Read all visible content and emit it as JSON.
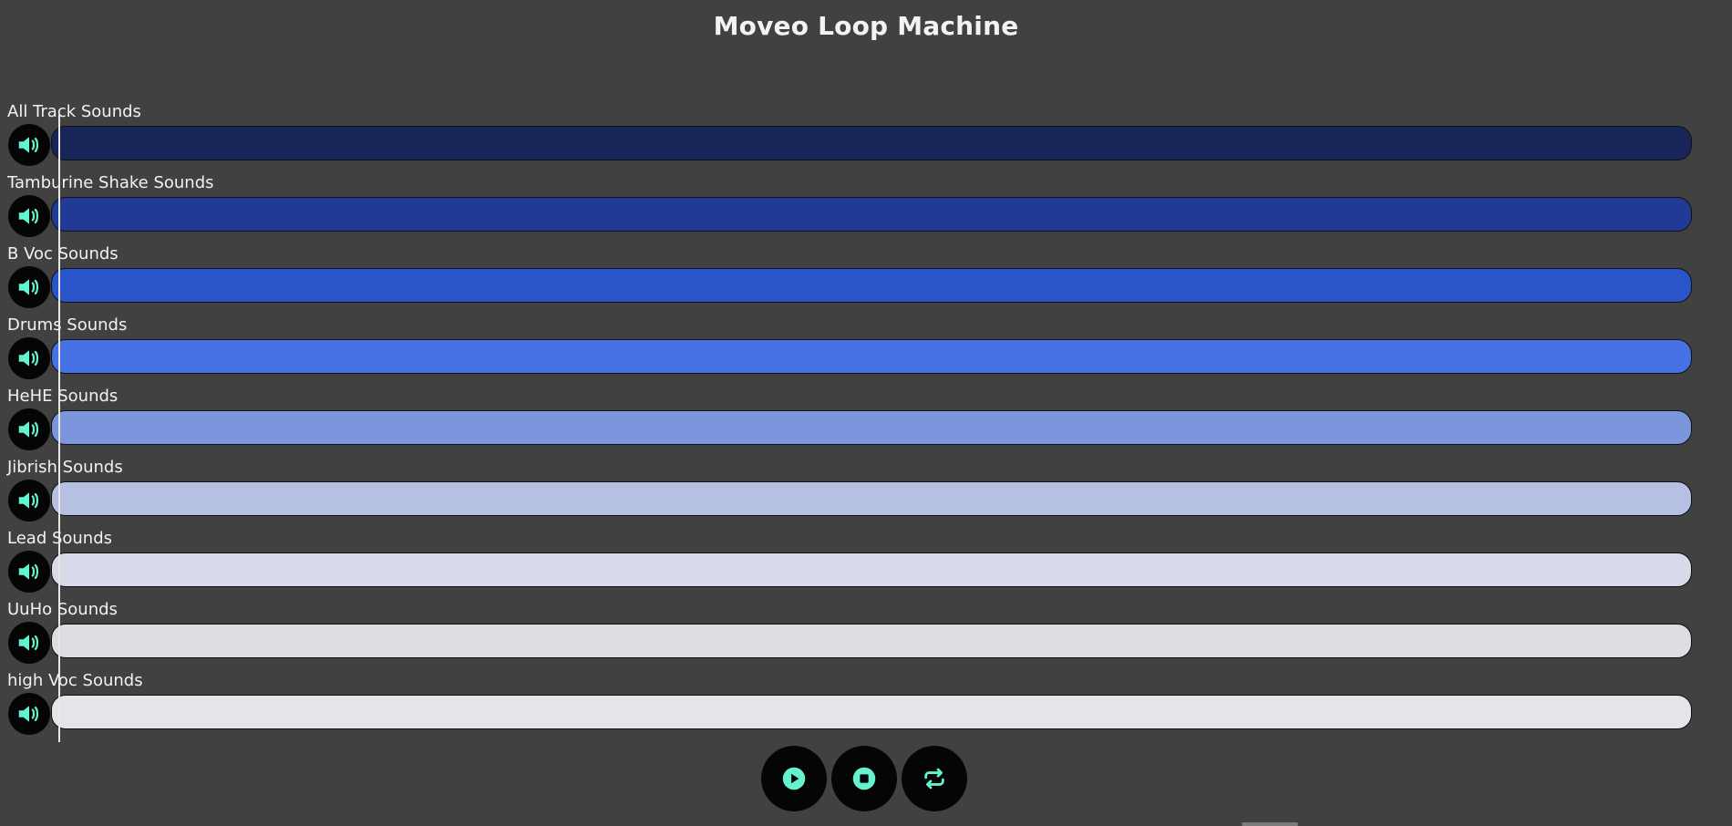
{
  "app": {
    "title": "Moveo Loop Machine"
  },
  "tracks": [
    {
      "label": "All Track Sounds",
      "color": "#182558"
    },
    {
      "label": "Tamburine Shake Sounds",
      "color": "#213a95"
    },
    {
      "label": "B Voc Sounds",
      "color": "#2a54ca"
    },
    {
      "label": "Drums Sounds",
      "color": "#4772e5"
    },
    {
      "label": "HeHE Sounds",
      "color": "#7b96dc"
    },
    {
      "label": "Jibrish Sounds",
      "color": "#b6c0e3"
    },
    {
      "label": "Lead Sounds",
      "color": "#d6dae9"
    },
    {
      "label": "UuHo Sounds",
      "color": "#dddde3"
    },
    {
      "label": "high Voc Sounds",
      "color": "#e4e4e9"
    }
  ],
  "icons": {
    "mute": "speaker-icon",
    "play": "play-icon",
    "stop": "stop-icon",
    "loop": "repeat-icon"
  },
  "colors": {
    "background": "#414141",
    "accent": "#64f2cf",
    "button_bg": "#050505"
  }
}
